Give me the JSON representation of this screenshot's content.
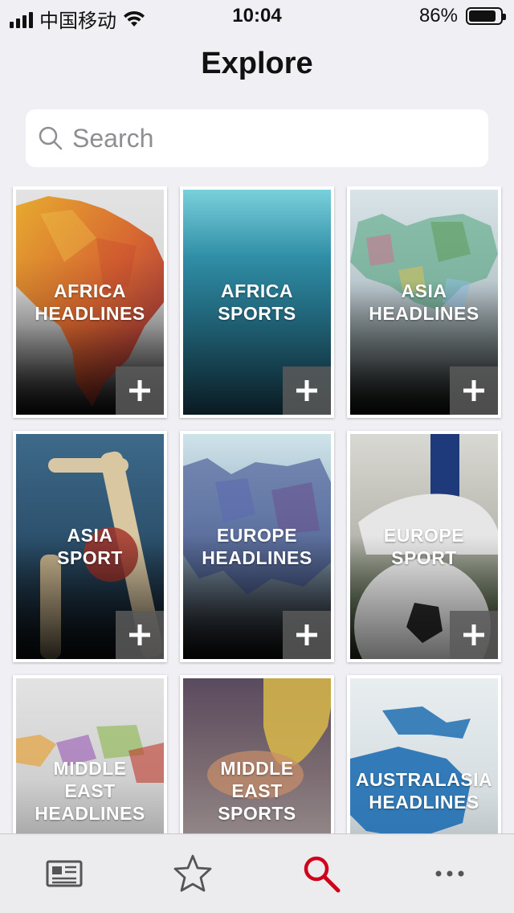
{
  "status_bar": {
    "carrier": "中国移动",
    "time": "10:04",
    "battery_text": "86%",
    "battery_level": 0.86
  },
  "header": {
    "title": "Explore"
  },
  "search": {
    "placeholder": "Search"
  },
  "tiles": [
    {
      "label": "AFRICA\nHEADLINES"
    },
    {
      "label": "AFRICA\nSPORTS"
    },
    {
      "label": "ASIA\nHEADLINES"
    },
    {
      "label": "ASIA\nSPORT"
    },
    {
      "label": "EUROPE\nHEADLINES"
    },
    {
      "label": "EUROPE\nSPORT"
    },
    {
      "label": "MIDDLE\nEAST\nHEADLINES"
    },
    {
      "label": "MIDDLE\nEAST\nSPORTS"
    },
    {
      "label": "AUSTRALASIA\nHEADLINES"
    }
  ],
  "tabbar": {
    "items": [
      {
        "icon": "newspaper-icon",
        "active": false
      },
      {
        "icon": "star-icon",
        "active": false
      },
      {
        "icon": "search-icon",
        "active": true
      },
      {
        "icon": "more-icon",
        "active": false
      }
    ],
    "active_color": "#d0021b"
  }
}
